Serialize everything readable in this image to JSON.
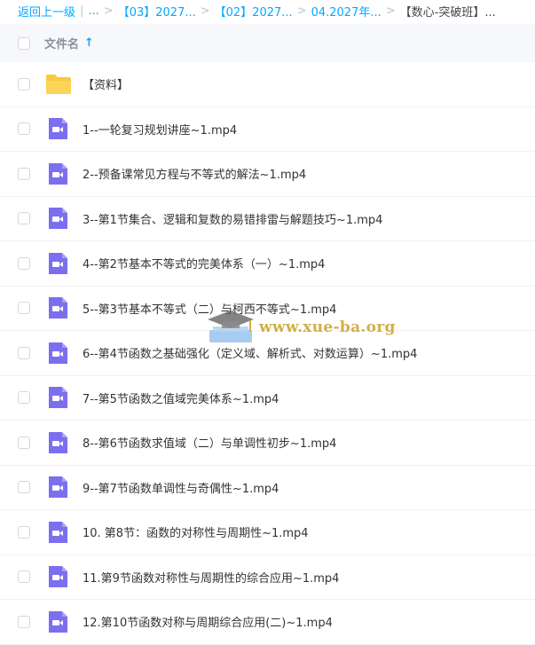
{
  "breadcrumb": {
    "back": "返回上一级",
    "sep": "|",
    "ellipsis": "...",
    "arrow": ">",
    "crumb1": "【03】2027...",
    "crumb2": "【02】2027...",
    "crumb3": "04.2027年...",
    "current": "【数心-突破班】..."
  },
  "header": {
    "column_label": "文件名",
    "sort_arrow": "↑"
  },
  "colors": {
    "accent": "#06a7ff",
    "video_icon": "#7b6ff0",
    "folder": "#f9c93e"
  },
  "files": [
    {
      "name": "【资料】",
      "icon": "folder-icon"
    },
    {
      "name": "1--一轮复习规划讲座~1.mp4",
      "icon": "video-file-icon"
    },
    {
      "name": "2--预备课常见方程与不等式的解法~1.mp4",
      "icon": "video-file-icon"
    },
    {
      "name": "3--第1节集合、逻辑和复数的易错排雷与解题技巧~1.mp4",
      "icon": "video-file-icon"
    },
    {
      "name": "4--第2节基本不等式的完美体系（一）~1.mp4",
      "icon": "video-file-icon"
    },
    {
      "name": "5--第3节基本不等式（二）与柯西不等式~1.mp4",
      "icon": "video-file-icon"
    },
    {
      "name": "6--第4节函数之基础强化（定义域、解析式、对数运算）~1.mp4",
      "icon": "video-file-icon"
    },
    {
      "name": "7--第5节函数之值域完美体系~1.mp4",
      "icon": "video-file-icon"
    },
    {
      "name": "8--第6节函数求值域（二）与单调性初步~1.mp4",
      "icon": "video-file-icon"
    },
    {
      "name": "9--第7节函数单调性与奇偶性~1.mp4",
      "icon": "video-file-icon"
    },
    {
      "name": "10. 第8节：函数的对称性与周期性~1.mp4",
      "icon": "video-file-icon"
    },
    {
      "name": "11.第9节函数对称性与周期性的综合应用~1.mp4",
      "icon": "video-file-icon"
    },
    {
      "name": "12.第10节函数对称与周期综合应用(二)~1.mp4",
      "icon": "video-file-icon"
    }
  ],
  "watermark": {
    "text": "www.xue-ba.org"
  }
}
